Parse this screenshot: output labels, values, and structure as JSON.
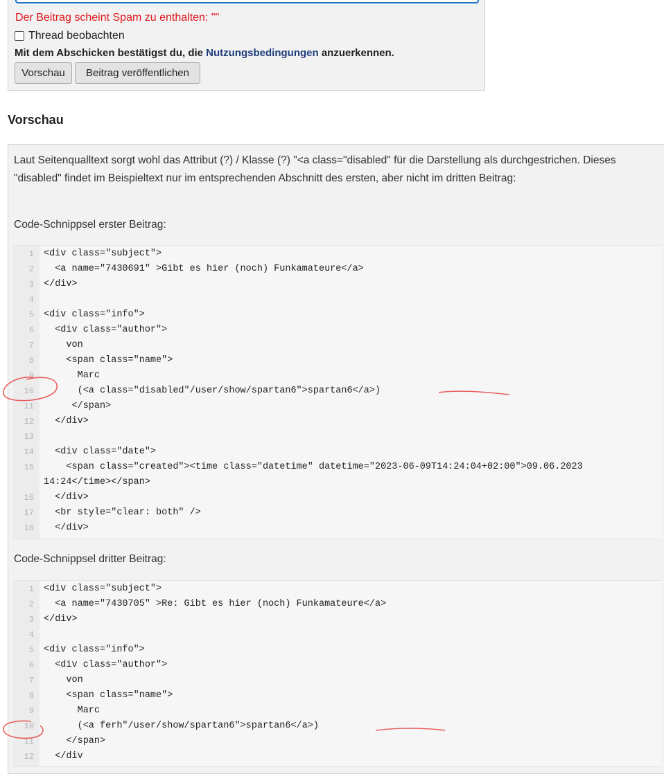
{
  "form": {
    "spam_error": "Der Beitrag scheint Spam zu enthalten: \"\"",
    "watch_label": "Thread beobachten",
    "terms_prefix": "Mit dem Abschicken bestätigst du, die ",
    "terms_link": "Nutzungsbedingungen",
    "terms_suffix": " anzuerkennen.",
    "preview_button": "Vorschau",
    "publish_button": "Beitrag veröffentlichen"
  },
  "preview": {
    "title": "Vorschau",
    "paragraph1": "Laut Seitenqualltext sorgt wohl das Attribut (?) / Klasse (?) \"<a class=\"disabled\" für die Darstellung als durchgestrichen. Dieses \"disabled\" findet im Beispieltext nur im entsprechenden Abschnitt des ersten, aber nicht im dritten Beitrag:",
    "paragraph2": "Code-Schnippsel erster Beitrag:",
    "paragraph3": "Code-Schnippsel dritter Beitrag:"
  },
  "code1": [
    {
      "n": "1",
      "t": "<div class=\"subject\">"
    },
    {
      "n": "2",
      "t": "  <a name=\"7430691\" >Gibt es hier (noch) Funkamateure</a>"
    },
    {
      "n": "3",
      "t": "</div>"
    },
    {
      "n": "4",
      "t": ""
    },
    {
      "n": "5",
      "t": "<div class=\"info\">"
    },
    {
      "n": "6",
      "t": "  <div class=\"author\">"
    },
    {
      "n": "7",
      "t": "    von"
    },
    {
      "n": "8",
      "t": "    <span class=\"name\">"
    },
    {
      "n": "9",
      "t": "      Marc"
    },
    {
      "n": "10",
      "t": "      (<a class=\"disabled\"/user/show/spartan6\">spartan6</a>)"
    },
    {
      "n": "11",
      "t": "     </span>"
    },
    {
      "n": "12",
      "t": "  </div>"
    },
    {
      "n": "13",
      "t": ""
    },
    {
      "n": "14",
      "t": "  <div class=\"date\">"
    },
    {
      "n": "15",
      "t": "    <span class=\"created\"><time class=\"datetime\" datetime=\"2023-06-09T14:24:04+02:00\">09.06.2023"
    },
    {
      "n": "",
      "t": "14:24</time></span>"
    },
    {
      "n": "16",
      "t": "  </div>"
    },
    {
      "n": "17",
      "t": "  <br style=\"clear: both\" />"
    },
    {
      "n": "18",
      "t": "  </div>"
    }
  ],
  "code2": [
    {
      "n": "1",
      "t": "<div class=\"subject\">"
    },
    {
      "n": "2",
      "t": "  <a name=\"7430705\" >Re: Gibt es hier (noch) Funkamateure</a>"
    },
    {
      "n": "3",
      "t": "</div>"
    },
    {
      "n": "4",
      "t": ""
    },
    {
      "n": "5",
      "t": "<div class=\"info\">"
    },
    {
      "n": "6",
      "t": "  <div class=\"author\">"
    },
    {
      "n": "7",
      "t": "    von"
    },
    {
      "n": "8",
      "t": "    <span class=\"name\">"
    },
    {
      "n": "9",
      "t": "      Marc"
    },
    {
      "n": "10",
      "t": "      (<a ferh\"/user/show/spartan6\">spartan6</a>)"
    },
    {
      "n": "11",
      "t": "    </span>"
    },
    {
      "n": "12",
      "t": "  </div"
    }
  ],
  "annotation_color": "#e8605f"
}
